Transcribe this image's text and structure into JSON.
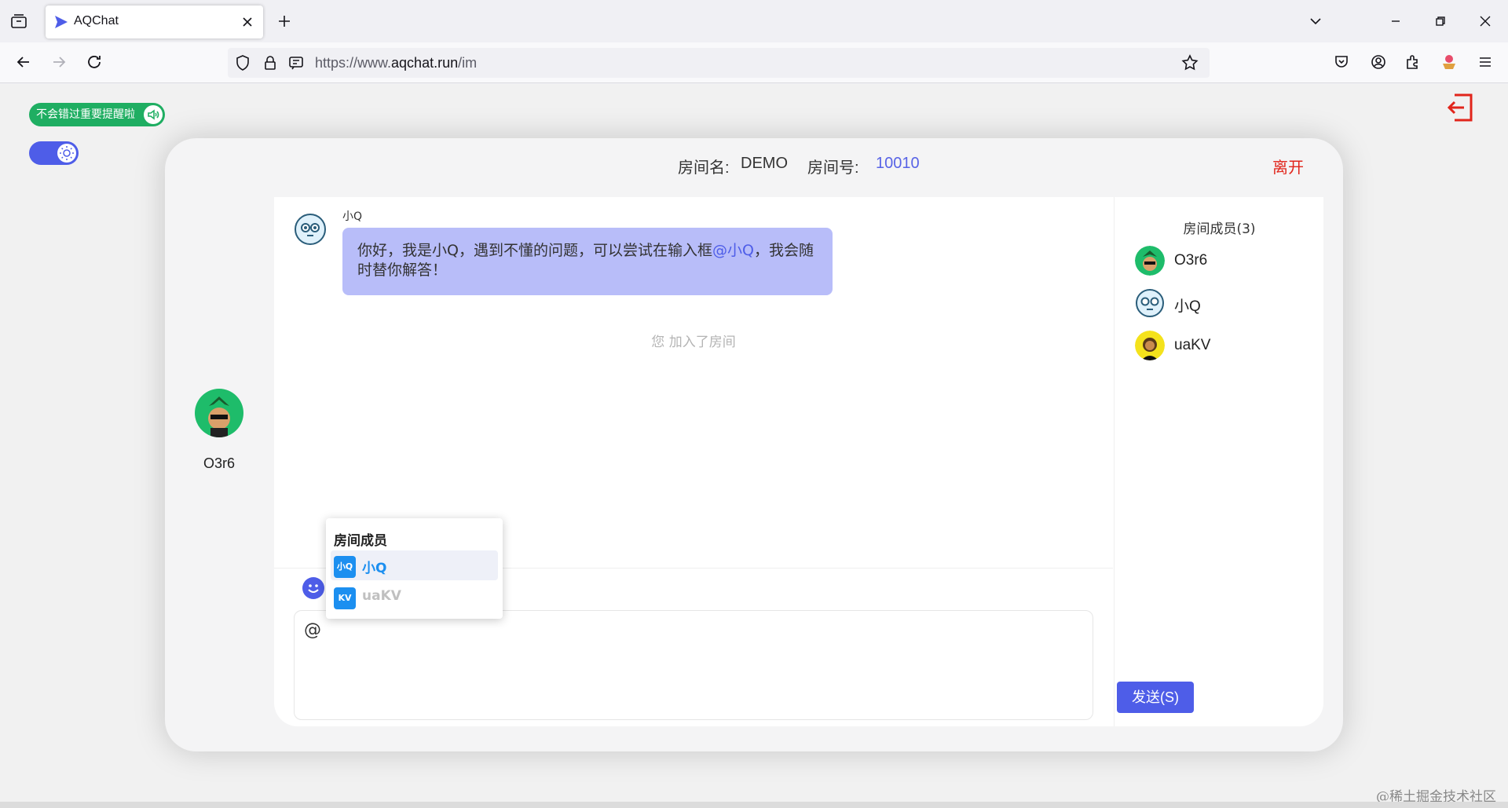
{
  "browser": {
    "tab_title": "AQChat",
    "url_prefix": "https://www.",
    "url_domain": "aqchat.run",
    "url_path": "/im"
  },
  "page": {
    "notify_toggle_label": "不会错过重要提醒啦",
    "room": {
      "name_label": "房间名:",
      "name": "DEMO",
      "number_label": "房间号:",
      "number": "10010",
      "leave_label": "离开"
    },
    "current_user": {
      "name": "O3r6"
    },
    "messages": [
      {
        "sender": "小Q",
        "text_before": "你好，我是小Q，遇到不懂的问题，可以尝试在输入框",
        "mention": "@小Q",
        "text_after": "，我会随时替你解答！"
      }
    ],
    "system_message": "您 加入了房间",
    "input_value": "@",
    "send_button_label": "发送(S)",
    "mention_popup": {
      "title": "房间成员",
      "items": [
        {
          "badge": "小Q",
          "label": "小Q",
          "active": true
        },
        {
          "badge": "KV",
          "label": "uaKV",
          "active": false
        }
      ]
    },
    "members": {
      "title": "房间成员(3)",
      "list": [
        {
          "name": "O3r6"
        },
        {
          "name": "小Q"
        },
        {
          "name": "uaKV"
        }
      ]
    },
    "watermark": "@稀土掘金技术社区"
  }
}
